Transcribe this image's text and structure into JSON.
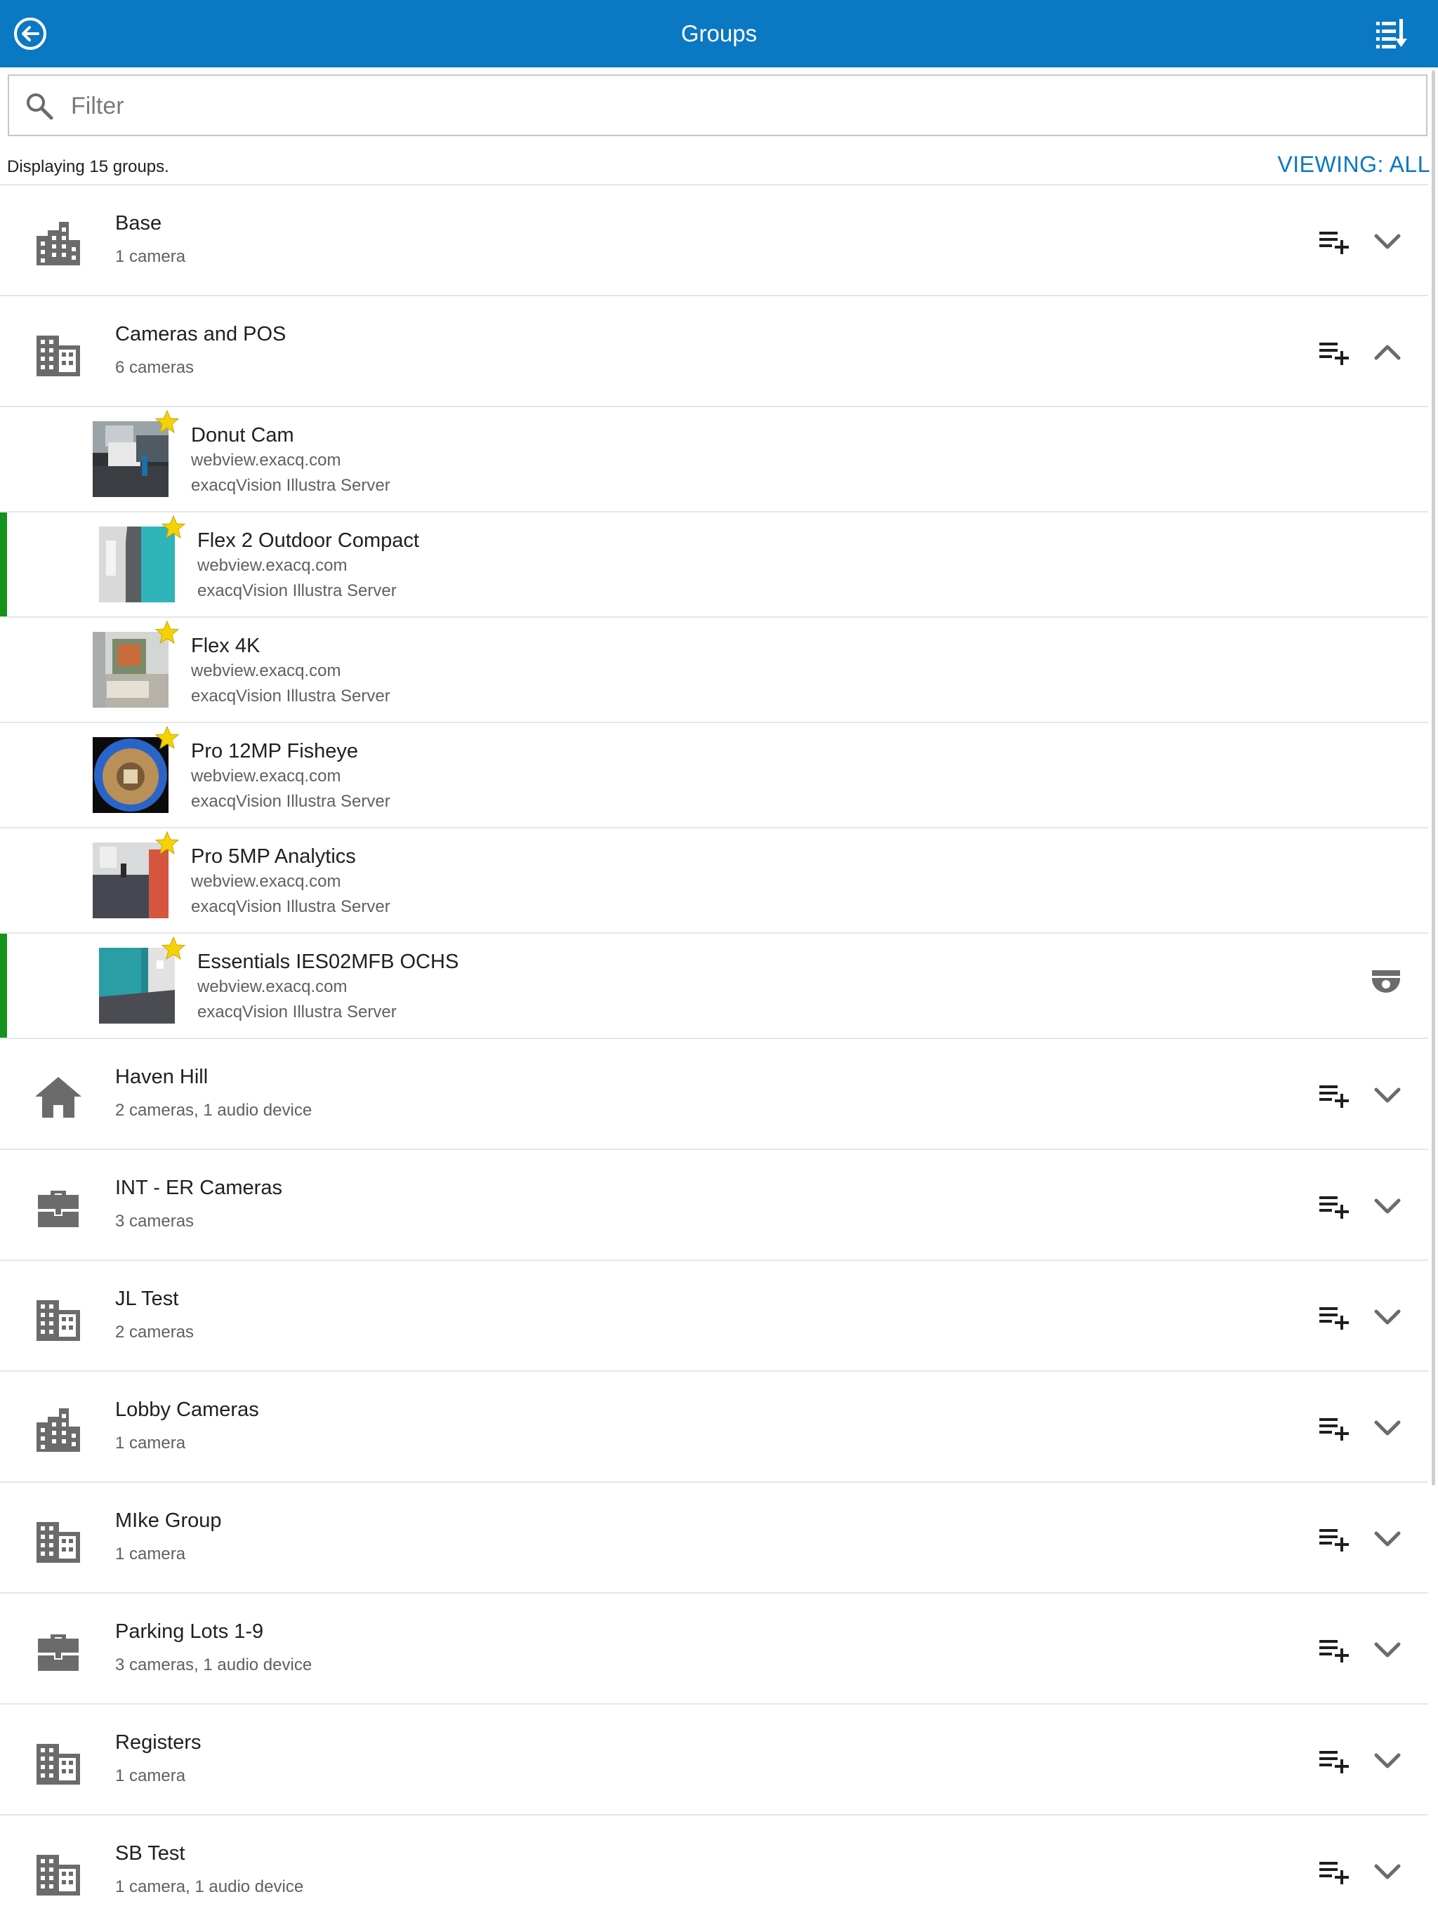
{
  "header": {
    "title": "Groups",
    "back_icon": "back-arrow-circle-icon",
    "sort_icon": "sort-list-icon",
    "color": "#0a78c2"
  },
  "filter": {
    "placeholder": "Filter",
    "value": ""
  },
  "summary": {
    "count_text": "Displaying 15 groups.",
    "viewing_text": "VIEWING: ALL"
  },
  "groups": [
    {
      "name": "Base",
      "sub": "1 camera",
      "icon": "city-icon",
      "expanded": false
    },
    {
      "name": "Cameras and POS",
      "sub": "6 cameras",
      "icon": "office-building-icon",
      "expanded": true,
      "cameras": [
        {
          "name": "Donut Cam",
          "host": "webview.exacq.com",
          "server": "exacqVision Illustra Server",
          "favorite": true,
          "active": false,
          "thumb": "office"
        },
        {
          "name": "Flex 2 Outdoor Compact",
          "host": "webview.exacq.com",
          "server": "exacqVision Illustra Server",
          "favorite": true,
          "active": true,
          "thumb": "hallway"
        },
        {
          "name": "Flex 4K",
          "host": "webview.exacq.com",
          "server": "exacqVision Illustra Server",
          "favorite": true,
          "active": false,
          "thumb": "room"
        },
        {
          "name": "Pro 12MP Fisheye",
          "host": "webview.exacq.com",
          "server": "exacqVision Illustra Server",
          "favorite": true,
          "active": false,
          "thumb": "fisheye"
        },
        {
          "name": "Pro 5MP Analytics",
          "host": "webview.exacq.com",
          "server": "exacqVision Illustra Server",
          "favorite": true,
          "active": false,
          "thumb": "corridor"
        },
        {
          "name": "Essentials IES02MFB OCHS",
          "host": "webview.exacq.com",
          "server": "exacqVision Illustra Server",
          "favorite": true,
          "active": true,
          "thumb": "teal-wall",
          "type_icon": "dome-camera-icon"
        }
      ]
    },
    {
      "name": "Haven Hill",
      "sub": "2 cameras, 1 audio device",
      "icon": "home-icon",
      "expanded": false
    },
    {
      "name": "INT - ER Cameras",
      "sub": "3 cameras",
      "icon": "briefcase-icon",
      "expanded": false
    },
    {
      "name": "JL Test",
      "sub": "2 cameras",
      "icon": "office-building-icon",
      "expanded": false
    },
    {
      "name": "Lobby Cameras",
      "sub": "1 camera",
      "icon": "city-icon",
      "expanded": false
    },
    {
      "name": "MIke Group",
      "sub": "1 camera",
      "icon": "office-building-icon",
      "expanded": false
    },
    {
      "name": "Parking Lots 1-9",
      "sub": "3 cameras, 1 audio device",
      "icon": "briefcase-icon",
      "expanded": false
    },
    {
      "name": "Registers",
      "sub": "1 camera",
      "icon": "office-building-icon",
      "expanded": false
    },
    {
      "name": "SB Test",
      "sub": "1 camera, 1 audio device",
      "icon": "office-building-icon",
      "expanded": false
    }
  ],
  "colors": {
    "accent": "#0a78c2",
    "active_bar": "#13921c",
    "star": "#f5d300",
    "icon_gray": "#6b6b6b"
  }
}
